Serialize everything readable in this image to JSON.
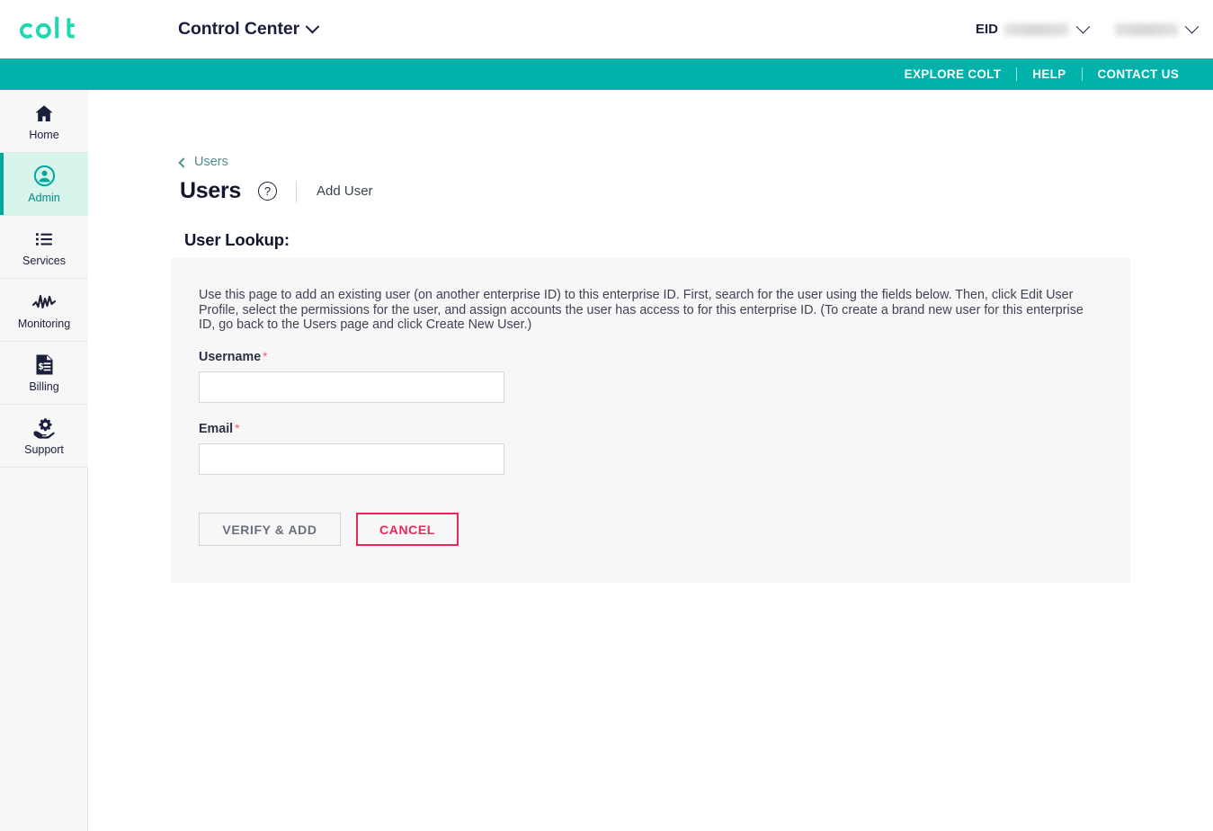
{
  "header": {
    "logo_text": "colt",
    "logo_color": "#1ed9af",
    "app_switcher_label": "Control Center",
    "eid_label": "EID",
    "eid_value_redacted": "",
    "account_value_redacted": ""
  },
  "teal_nav": {
    "background_color": "#00b2a9",
    "links": [
      {
        "label": "EXPLORE COLT"
      },
      {
        "label": "HELP"
      },
      {
        "label": "CONTACT US"
      }
    ]
  },
  "sidebar": {
    "items": [
      {
        "label": "Home",
        "icon": "home-icon",
        "active": false
      },
      {
        "label": "Admin",
        "icon": "user-circle-icon",
        "active": true
      },
      {
        "label": "Services",
        "icon": "list-icon",
        "active": false
      },
      {
        "label": "Monitoring",
        "icon": "waveform-icon",
        "active": false
      },
      {
        "label": "Billing",
        "icon": "invoice-icon",
        "active": false
      },
      {
        "label": "Support",
        "icon": "gear-hand-icon",
        "active": false
      }
    ],
    "active_background": "#d8f5ec",
    "active_accent": "#00a79d"
  },
  "main": {
    "breadcrumb": {
      "label": "Users",
      "icon": "chevron-left-icon"
    },
    "page_title": "Users",
    "help_icon_glyph": "?",
    "subtab": "Add User",
    "section_heading": "User Lookup:",
    "panel": {
      "description": "Use this page to add an existing user (on another enterprise ID) to this enterprise ID. First, search for the user using the fields below. Then, click Edit User Profile, select the permissions for the user, and assign accounts the user has access to for this enterprise ID. (To create a brand new user for this enterprise ID, go back to the Users page and click Create New User.)",
      "fields": [
        {
          "label": "Username",
          "required_marker": "*",
          "value": "",
          "placeholder": ""
        },
        {
          "label": "Email",
          "required_marker": "*",
          "value": "",
          "placeholder": ""
        }
      ],
      "buttons": [
        {
          "label": "VERIFY & ADD",
          "style": "disabled-outline",
          "color": "#6b6f7d"
        },
        {
          "label": "CANCEL",
          "style": "outline",
          "color": "#e8295a"
        }
      ]
    }
  }
}
